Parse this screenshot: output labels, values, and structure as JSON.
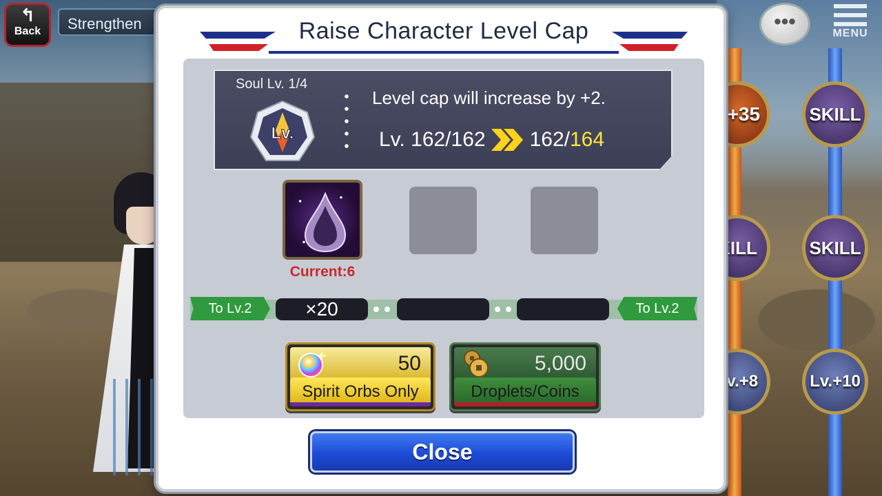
{
  "hud": {
    "back_label": "Back",
    "screen_title": "Strengthen",
    "menu_label": "MENU",
    "chat_glyph": "•••"
  },
  "skill_tree": {
    "nodes": [
      {
        "label": "S+35",
        "kind": "stat"
      },
      {
        "label": "SKILL",
        "kind": "skill"
      },
      {
        "label": "KILL",
        "kind": "skill"
      },
      {
        "label": "SKILL",
        "kind": "skill"
      },
      {
        "label": "Lv.+8",
        "kind": "lv"
      },
      {
        "label": "Lv.+10",
        "kind": "lv"
      }
    ]
  },
  "dialog": {
    "title": "Raise Character Level Cap",
    "soul_level": "Soul Lv. 1/4",
    "badge_text": "Lv.",
    "description": "Level cap will increase by +2.",
    "level_prefix": "Lv. 162/162",
    "level_new_base": "162/",
    "level_new_cap": "164",
    "material_current": "Current:6",
    "track": {
      "left_tag": "To Lv.2",
      "right_tag": "To Lv.2",
      "qty_1": "×20",
      "qty_2": "",
      "qty_3": ""
    },
    "buttons": {
      "orbs_cost": "50",
      "orbs_label": "Spirit Orbs Only",
      "coins_cost": "5,000",
      "coins_label": "Droplets/Coins",
      "close_label": "Close"
    }
  },
  "colors": {
    "highlight_yellow": "#ffe63a",
    "current_red": "#c9282e",
    "close_blue": "#1c4bd6",
    "track_green": "#2f9a3e"
  }
}
